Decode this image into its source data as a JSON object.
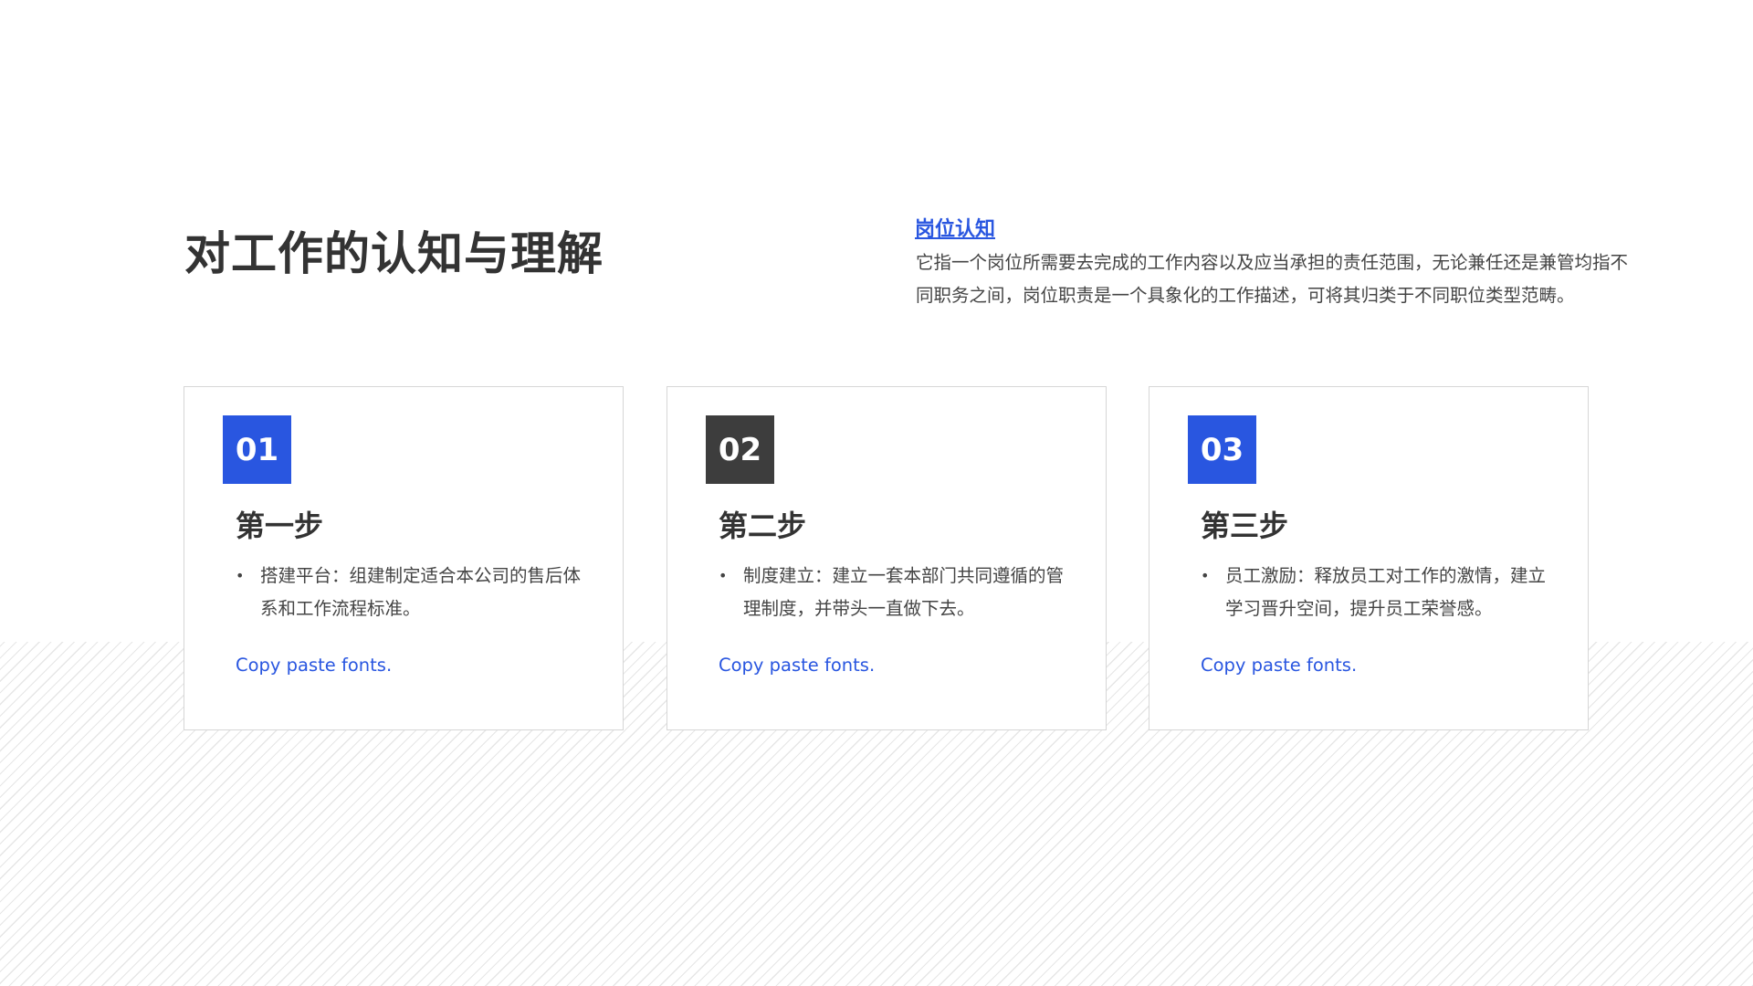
{
  "slide": {
    "title": "对工作的认知与理解",
    "subtitle": "岗位认知",
    "description": "它指一个岗位所需要去完成的工作内容以及应当承担的责任范围，无论兼任还是兼管均指不同职务之间，岗位职责是一个具象化的工作描述，可将其归类于不同职位类型范畴。"
  },
  "cards": [
    {
      "number": "01",
      "number_bg": "#2956e0",
      "title": "第一步",
      "bullet": "搭建平台：组建制定适合本公司的售后体系和工作流程标准。",
      "link": "Copy paste fonts."
    },
    {
      "number": "02",
      "number_bg": "#3d3d3d",
      "title": "第二步",
      "bullet": "制度建立：建立一套本部门共同遵循的管理制度，并带头一直做下去。",
      "link": "Copy paste fonts."
    },
    {
      "number": "03",
      "number_bg": "#2956e0",
      "title": "第三步",
      "bullet": "员工激励：释放员工对工作的激情，建立学习晋升空间，提升员工荣誉感。",
      "link": "Copy paste fonts."
    }
  ],
  "colors": {
    "accent": "#2956e0",
    "dark": "#3d3d3d",
    "text": "#444444",
    "heading": "#333333"
  }
}
